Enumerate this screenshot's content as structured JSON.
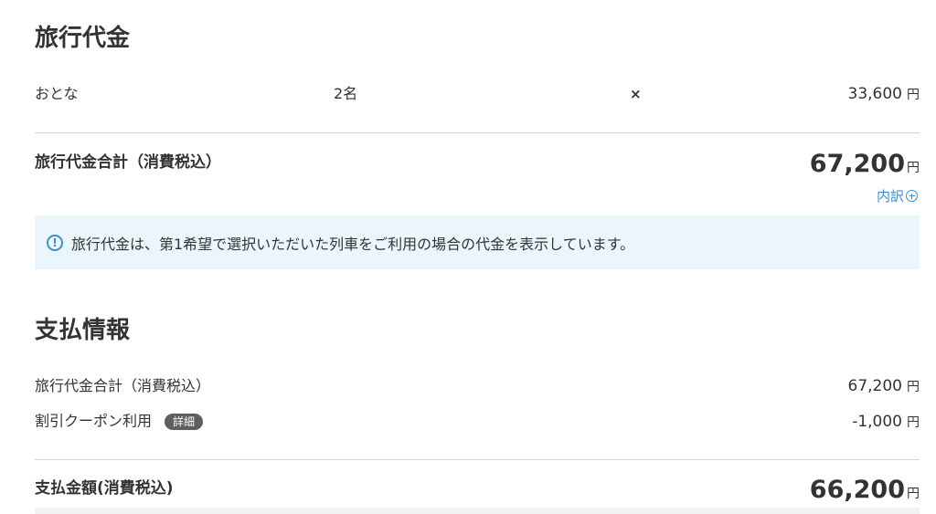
{
  "travel_fee": {
    "title": "旅行代金",
    "adult_label": "おとな",
    "adult_count": "2名",
    "multiply": "×",
    "unit_price": "33,600",
    "yen": "円",
    "total_label": "旅行代金合計（消費税込）",
    "total_amount": "67,200",
    "breakdown_link": "内訳",
    "notice_icon": "!",
    "notice": "旅行代金は、第1希望で選択いただいた列車をご利用の場合の代金を表示しています。"
  },
  "payment": {
    "title": "支払情報",
    "subtotal_label": "旅行代金合計（消費税込）",
    "subtotal_amount": "67,200",
    "coupon_label": "割引クーポン利用",
    "coupon_detail": "詳細",
    "coupon_amount": "-1,000",
    "yen": "円",
    "pay_label": "支払金額(消費税込)",
    "pay_amount": "66,200"
  },
  "icons": {
    "info": "info-circle-icon",
    "breakdown": "plus-circle-icon"
  },
  "colors": {
    "accent": "#3a8fd1",
    "notice_bg": "#eaf6fb",
    "badge_bg": "#5f5f5f",
    "text": "#333333",
    "divider": "#d4d4d4"
  }
}
